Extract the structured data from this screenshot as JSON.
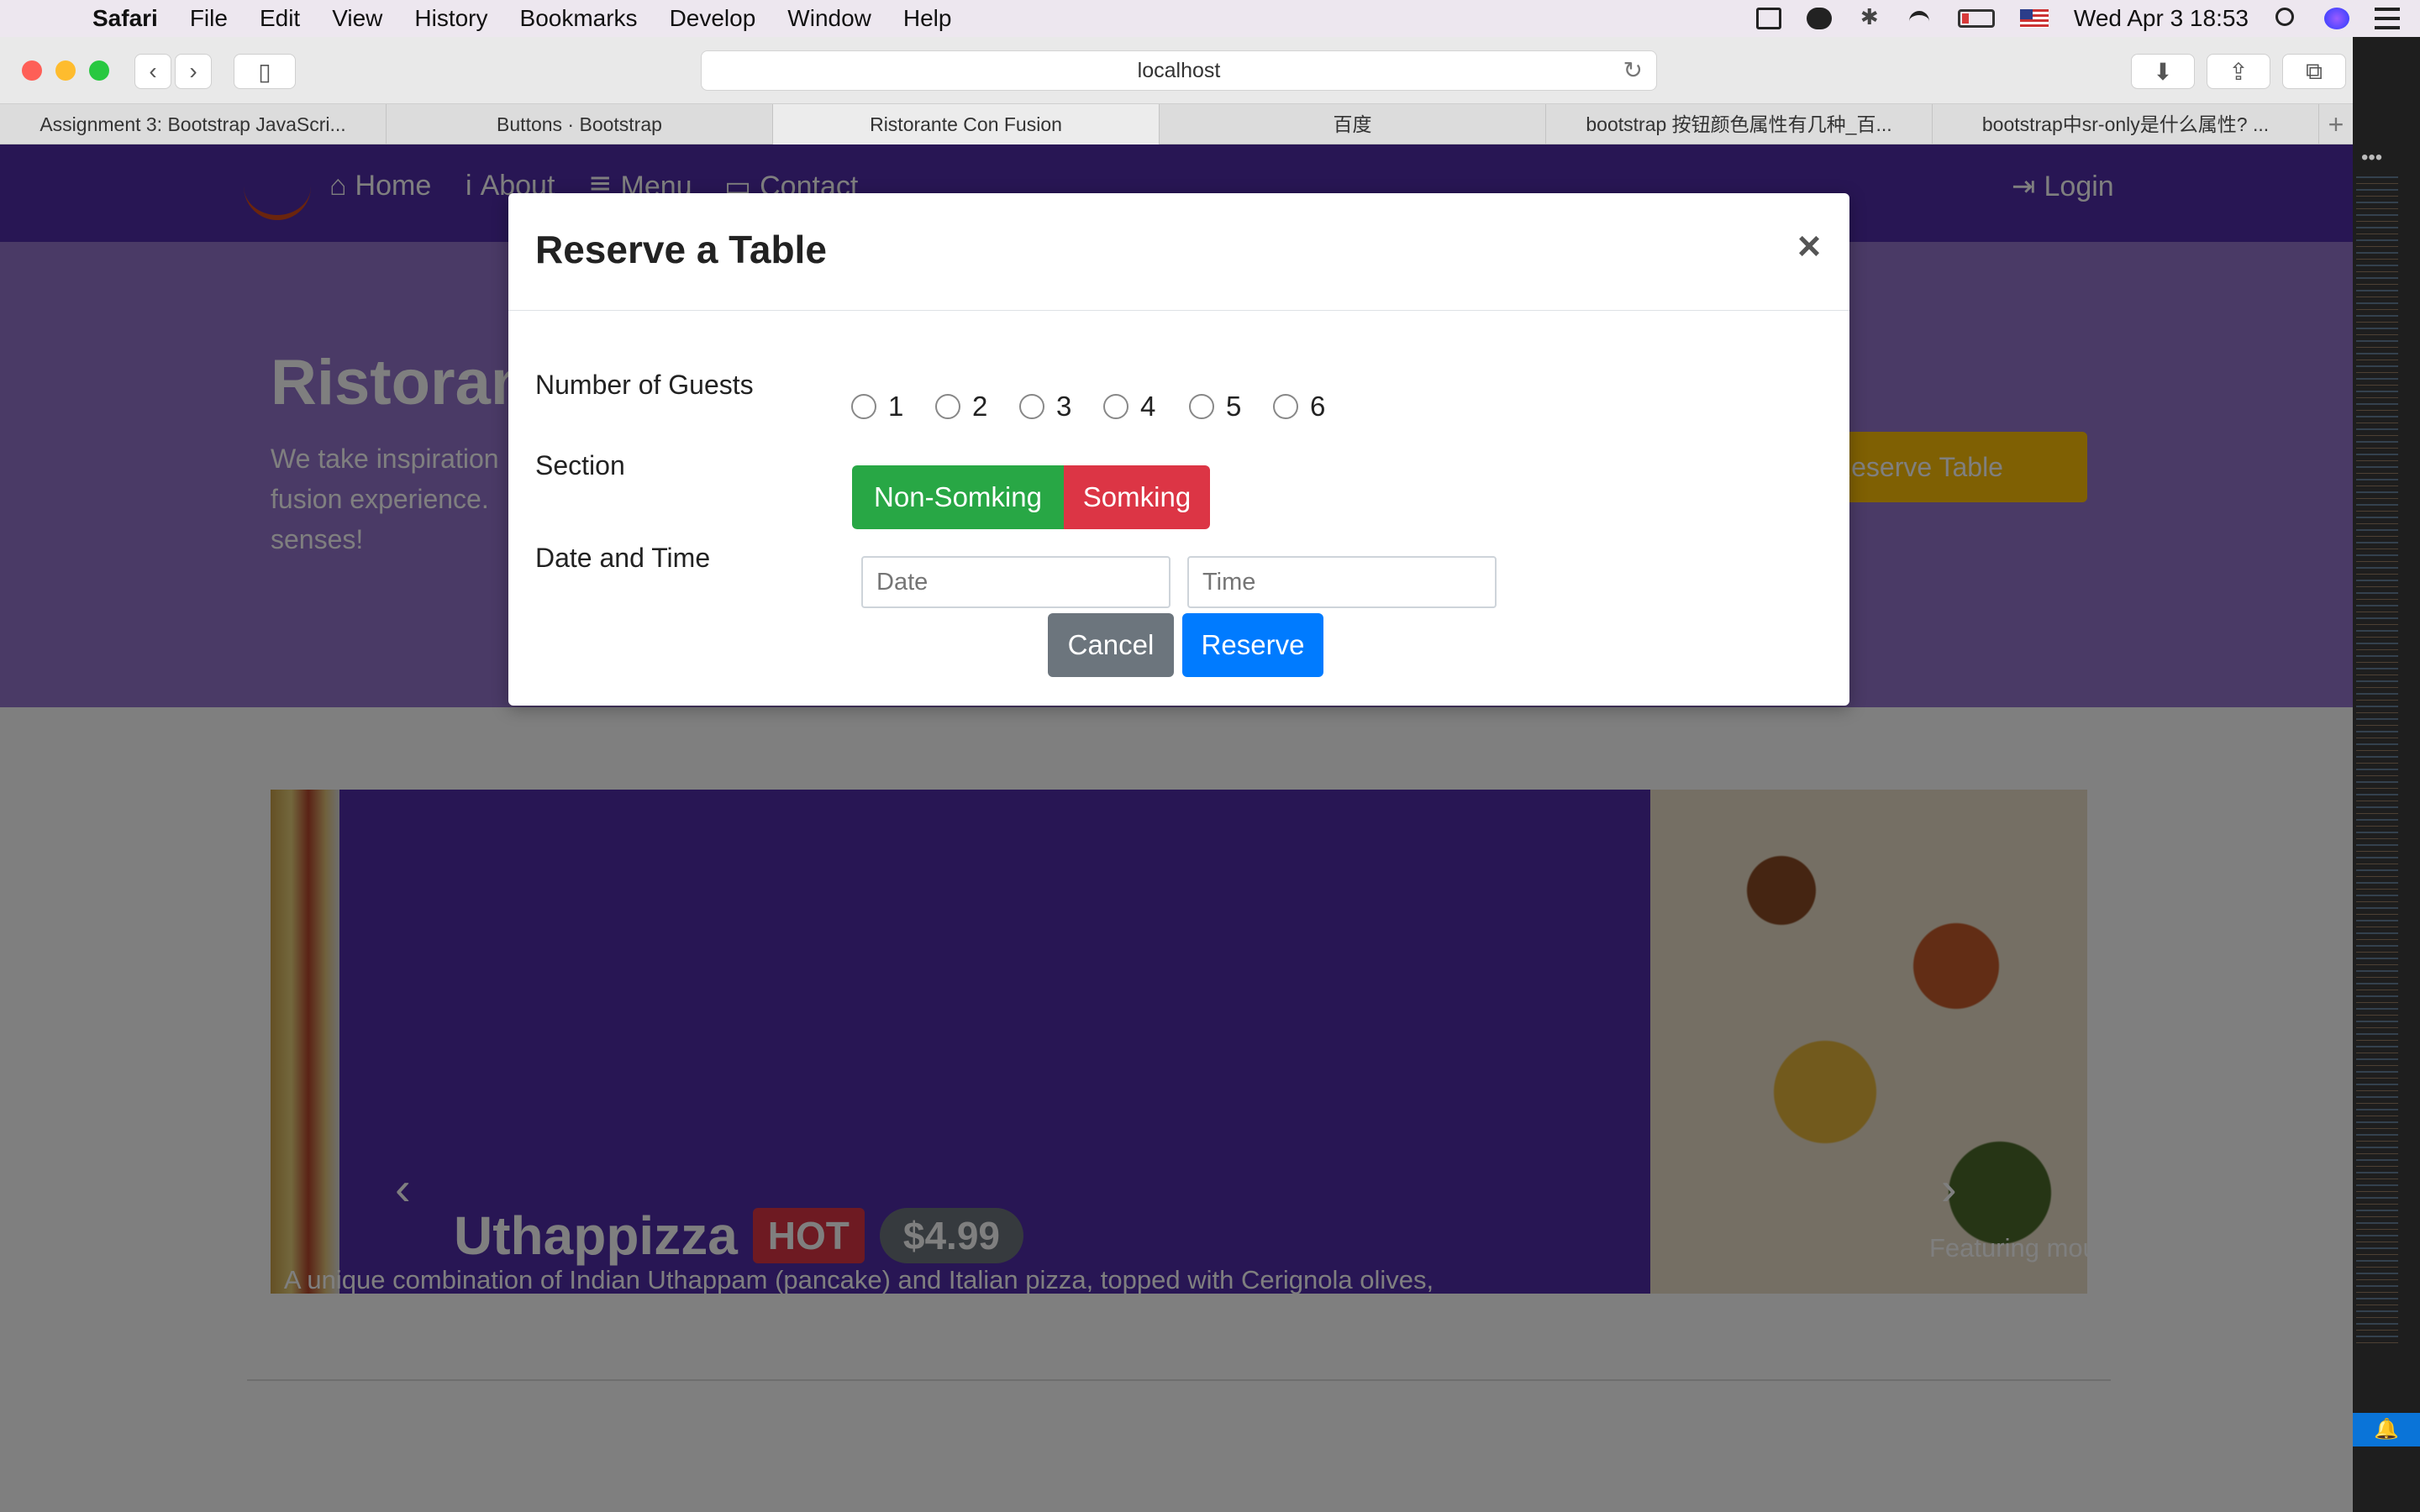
{
  "menubar": {
    "app": "Safari",
    "items": [
      "File",
      "Edit",
      "View",
      "History",
      "Bookmarks",
      "Develop",
      "Window",
      "Help"
    ],
    "clock": "Wed Apr 3  18:53"
  },
  "browser": {
    "address": "localhost",
    "tabs": [
      "Assignment 3: Bootstrap JavaScri...",
      "Buttons · Bootstrap",
      "Ristorante Con Fusion",
      "百度",
      "bootstrap 按钮颜色属性有几种_百...",
      "bootstrap中sr-only是什么属性? ..."
    ],
    "new_tab": "+"
  },
  "site": {
    "nav": {
      "home": "Home",
      "about": "About",
      "menu": "Menu",
      "contact": "Contact",
      "login": "Login"
    },
    "jumbotron": {
      "title": "Ristorante",
      "text": "We take inspiration fusion experience. senses!",
      "reserve_button": "Reserve Table"
    },
    "carousel": {
      "dish": "Uthappizza",
      "badge": "HOT",
      "price": "$4.99",
      "description": "A unique combination of Indian Uthappam (pancake) and Italian pizza, topped with Cerignola olives, ripe vine cherry tomatoes, Vidalia onion, Guntur chillies and Buffalo Paneer.",
      "side_caption": "Featuring mouthwatering main entrees"
    }
  },
  "modal": {
    "title": "Reserve a Table",
    "close": "×",
    "guests_label": "Number of Guests",
    "guests_options": [
      "1",
      "2",
      "3",
      "4",
      "5",
      "6"
    ],
    "section_label": "Section",
    "section_options": [
      "Non-Somking",
      "Somking"
    ],
    "datetime_label": "Date and Time",
    "date_placeholder": "Date",
    "time_placeholder": "Time",
    "cancel": "Cancel",
    "reserve": "Reserve"
  },
  "colors": {
    "primary": "#512da8",
    "jumbotron": "#9575cd",
    "success": "#28a745",
    "danger": "#dc3545",
    "secondary": "#6c757d",
    "blue": "#007bff",
    "warning": "#ffc107"
  }
}
